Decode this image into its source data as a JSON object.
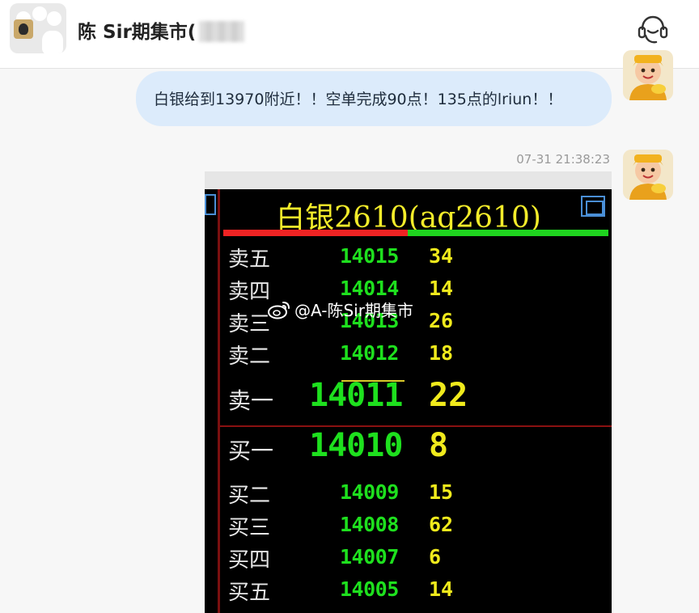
{
  "header": {
    "title": "陈 Sir期集市("
  },
  "messages": [
    {
      "type": "text",
      "text": "白银给到13970附近！！空单完成90点！135点的lriun！！"
    },
    {
      "type": "image",
      "timestamp": "07-31 21:38:23",
      "image": {
        "title": "白银2610(ag2610)",
        "watermark": "@A-陈Sir期集市",
        "sell_rows": [
          {
            "label": "卖五",
            "price": "14015",
            "volume": "34"
          },
          {
            "label": "卖四",
            "price": "14014",
            "volume": "14"
          },
          {
            "label": "卖三",
            "price": "14013",
            "volume": "26"
          },
          {
            "label": "卖二",
            "price": "14012",
            "volume": "18"
          },
          {
            "label": "卖一",
            "price": "14011",
            "volume": "22"
          }
        ],
        "buy_rows": [
          {
            "label": "买一",
            "price": "14010",
            "volume": "8"
          },
          {
            "label": "买二",
            "price": "14009",
            "volume": "15"
          },
          {
            "label": "买三",
            "price": "14008",
            "volume": "62"
          },
          {
            "label": "买四",
            "price": "14007",
            "volume": "6"
          },
          {
            "label": "买五",
            "price": "14005",
            "volume": "14"
          }
        ]
      }
    }
  ],
  "icons": {
    "group_avatar": "group-avatar-icon",
    "service": "customer-service-icon",
    "weibo": "weibo-icon"
  },
  "colors": {
    "bubble": "#dcebfb",
    "price_green": "#1ee01e",
    "volume_yellow": "#f0ea1c",
    "title_yellow": "#f3ec2a",
    "sell_bar": "#ef2323",
    "buy_bar": "#1fd41f"
  }
}
